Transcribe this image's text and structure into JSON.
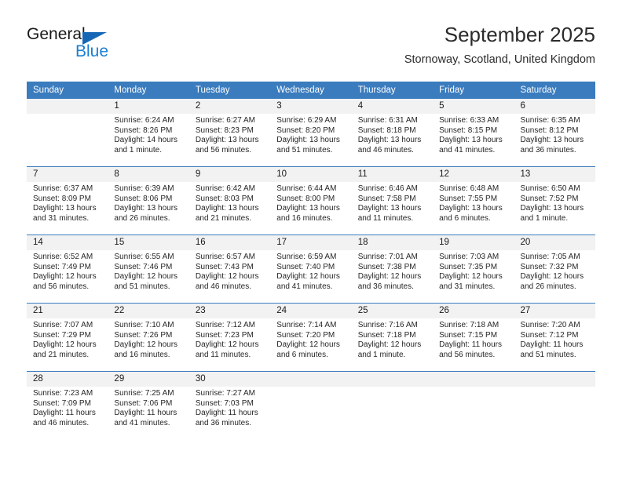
{
  "brand": {
    "name_top": "General",
    "name_bottom": "Blue",
    "accent_color": "#1a7fd4",
    "triangle_color": "#1567b5"
  },
  "header": {
    "title": "September 2025",
    "location": "Stornoway, Scotland, United Kingdom",
    "header_bg": "#3b7cbe"
  },
  "calendar": {
    "weekday_headers": [
      "Sunday",
      "Monday",
      "Tuesday",
      "Wednesday",
      "Thursday",
      "Friday",
      "Saturday"
    ],
    "weeks": [
      [
        {
          "day": "",
          "sunrise": "",
          "sunset": "",
          "daylight": ""
        },
        {
          "day": "1",
          "sunrise": "Sunrise: 6:24 AM",
          "sunset": "Sunset: 8:26 PM",
          "daylight": "Daylight: 14 hours and 1 minute."
        },
        {
          "day": "2",
          "sunrise": "Sunrise: 6:27 AM",
          "sunset": "Sunset: 8:23 PM",
          "daylight": "Daylight: 13 hours and 56 minutes."
        },
        {
          "day": "3",
          "sunrise": "Sunrise: 6:29 AM",
          "sunset": "Sunset: 8:20 PM",
          "daylight": "Daylight: 13 hours and 51 minutes."
        },
        {
          "day": "4",
          "sunrise": "Sunrise: 6:31 AM",
          "sunset": "Sunset: 8:18 PM",
          "daylight": "Daylight: 13 hours and 46 minutes."
        },
        {
          "day": "5",
          "sunrise": "Sunrise: 6:33 AM",
          "sunset": "Sunset: 8:15 PM",
          "daylight": "Daylight: 13 hours and 41 minutes."
        },
        {
          "day": "6",
          "sunrise": "Sunrise: 6:35 AM",
          "sunset": "Sunset: 8:12 PM",
          "daylight": "Daylight: 13 hours and 36 minutes."
        }
      ],
      [
        {
          "day": "7",
          "sunrise": "Sunrise: 6:37 AM",
          "sunset": "Sunset: 8:09 PM",
          "daylight": "Daylight: 13 hours and 31 minutes."
        },
        {
          "day": "8",
          "sunrise": "Sunrise: 6:39 AM",
          "sunset": "Sunset: 8:06 PM",
          "daylight": "Daylight: 13 hours and 26 minutes."
        },
        {
          "day": "9",
          "sunrise": "Sunrise: 6:42 AM",
          "sunset": "Sunset: 8:03 PM",
          "daylight": "Daylight: 13 hours and 21 minutes."
        },
        {
          "day": "10",
          "sunrise": "Sunrise: 6:44 AM",
          "sunset": "Sunset: 8:00 PM",
          "daylight": "Daylight: 13 hours and 16 minutes."
        },
        {
          "day": "11",
          "sunrise": "Sunrise: 6:46 AM",
          "sunset": "Sunset: 7:58 PM",
          "daylight": "Daylight: 13 hours and 11 minutes."
        },
        {
          "day": "12",
          "sunrise": "Sunrise: 6:48 AM",
          "sunset": "Sunset: 7:55 PM",
          "daylight": "Daylight: 13 hours and 6 minutes."
        },
        {
          "day": "13",
          "sunrise": "Sunrise: 6:50 AM",
          "sunset": "Sunset: 7:52 PM",
          "daylight": "Daylight: 13 hours and 1 minute."
        }
      ],
      [
        {
          "day": "14",
          "sunrise": "Sunrise: 6:52 AM",
          "sunset": "Sunset: 7:49 PM",
          "daylight": "Daylight: 12 hours and 56 minutes."
        },
        {
          "day": "15",
          "sunrise": "Sunrise: 6:55 AM",
          "sunset": "Sunset: 7:46 PM",
          "daylight": "Daylight: 12 hours and 51 minutes."
        },
        {
          "day": "16",
          "sunrise": "Sunrise: 6:57 AM",
          "sunset": "Sunset: 7:43 PM",
          "daylight": "Daylight: 12 hours and 46 minutes."
        },
        {
          "day": "17",
          "sunrise": "Sunrise: 6:59 AM",
          "sunset": "Sunset: 7:40 PM",
          "daylight": "Daylight: 12 hours and 41 minutes."
        },
        {
          "day": "18",
          "sunrise": "Sunrise: 7:01 AM",
          "sunset": "Sunset: 7:38 PM",
          "daylight": "Daylight: 12 hours and 36 minutes."
        },
        {
          "day": "19",
          "sunrise": "Sunrise: 7:03 AM",
          "sunset": "Sunset: 7:35 PM",
          "daylight": "Daylight: 12 hours and 31 minutes."
        },
        {
          "day": "20",
          "sunrise": "Sunrise: 7:05 AM",
          "sunset": "Sunset: 7:32 PM",
          "daylight": "Daylight: 12 hours and 26 minutes."
        }
      ],
      [
        {
          "day": "21",
          "sunrise": "Sunrise: 7:07 AM",
          "sunset": "Sunset: 7:29 PM",
          "daylight": "Daylight: 12 hours and 21 minutes."
        },
        {
          "day": "22",
          "sunrise": "Sunrise: 7:10 AM",
          "sunset": "Sunset: 7:26 PM",
          "daylight": "Daylight: 12 hours and 16 minutes."
        },
        {
          "day": "23",
          "sunrise": "Sunrise: 7:12 AM",
          "sunset": "Sunset: 7:23 PM",
          "daylight": "Daylight: 12 hours and 11 minutes."
        },
        {
          "day": "24",
          "sunrise": "Sunrise: 7:14 AM",
          "sunset": "Sunset: 7:20 PM",
          "daylight": "Daylight: 12 hours and 6 minutes."
        },
        {
          "day": "25",
          "sunrise": "Sunrise: 7:16 AM",
          "sunset": "Sunset: 7:18 PM",
          "daylight": "Daylight: 12 hours and 1 minute."
        },
        {
          "day": "26",
          "sunrise": "Sunrise: 7:18 AM",
          "sunset": "Sunset: 7:15 PM",
          "daylight": "Daylight: 11 hours and 56 minutes."
        },
        {
          "day": "27",
          "sunrise": "Sunrise: 7:20 AM",
          "sunset": "Sunset: 7:12 PM",
          "daylight": "Daylight: 11 hours and 51 minutes."
        }
      ],
      [
        {
          "day": "28",
          "sunrise": "Sunrise: 7:23 AM",
          "sunset": "Sunset: 7:09 PM",
          "daylight": "Daylight: 11 hours and 46 minutes."
        },
        {
          "day": "29",
          "sunrise": "Sunrise: 7:25 AM",
          "sunset": "Sunset: 7:06 PM",
          "daylight": "Daylight: 11 hours and 41 minutes."
        },
        {
          "day": "30",
          "sunrise": "Sunrise: 7:27 AM",
          "sunset": "Sunset: 7:03 PM",
          "daylight": "Daylight: 11 hours and 36 minutes."
        },
        {
          "day": "",
          "sunrise": "",
          "sunset": "",
          "daylight": ""
        },
        {
          "day": "",
          "sunrise": "",
          "sunset": "",
          "daylight": ""
        },
        {
          "day": "",
          "sunrise": "",
          "sunset": "",
          "daylight": ""
        },
        {
          "day": "",
          "sunrise": "",
          "sunset": "",
          "daylight": ""
        }
      ]
    ]
  }
}
